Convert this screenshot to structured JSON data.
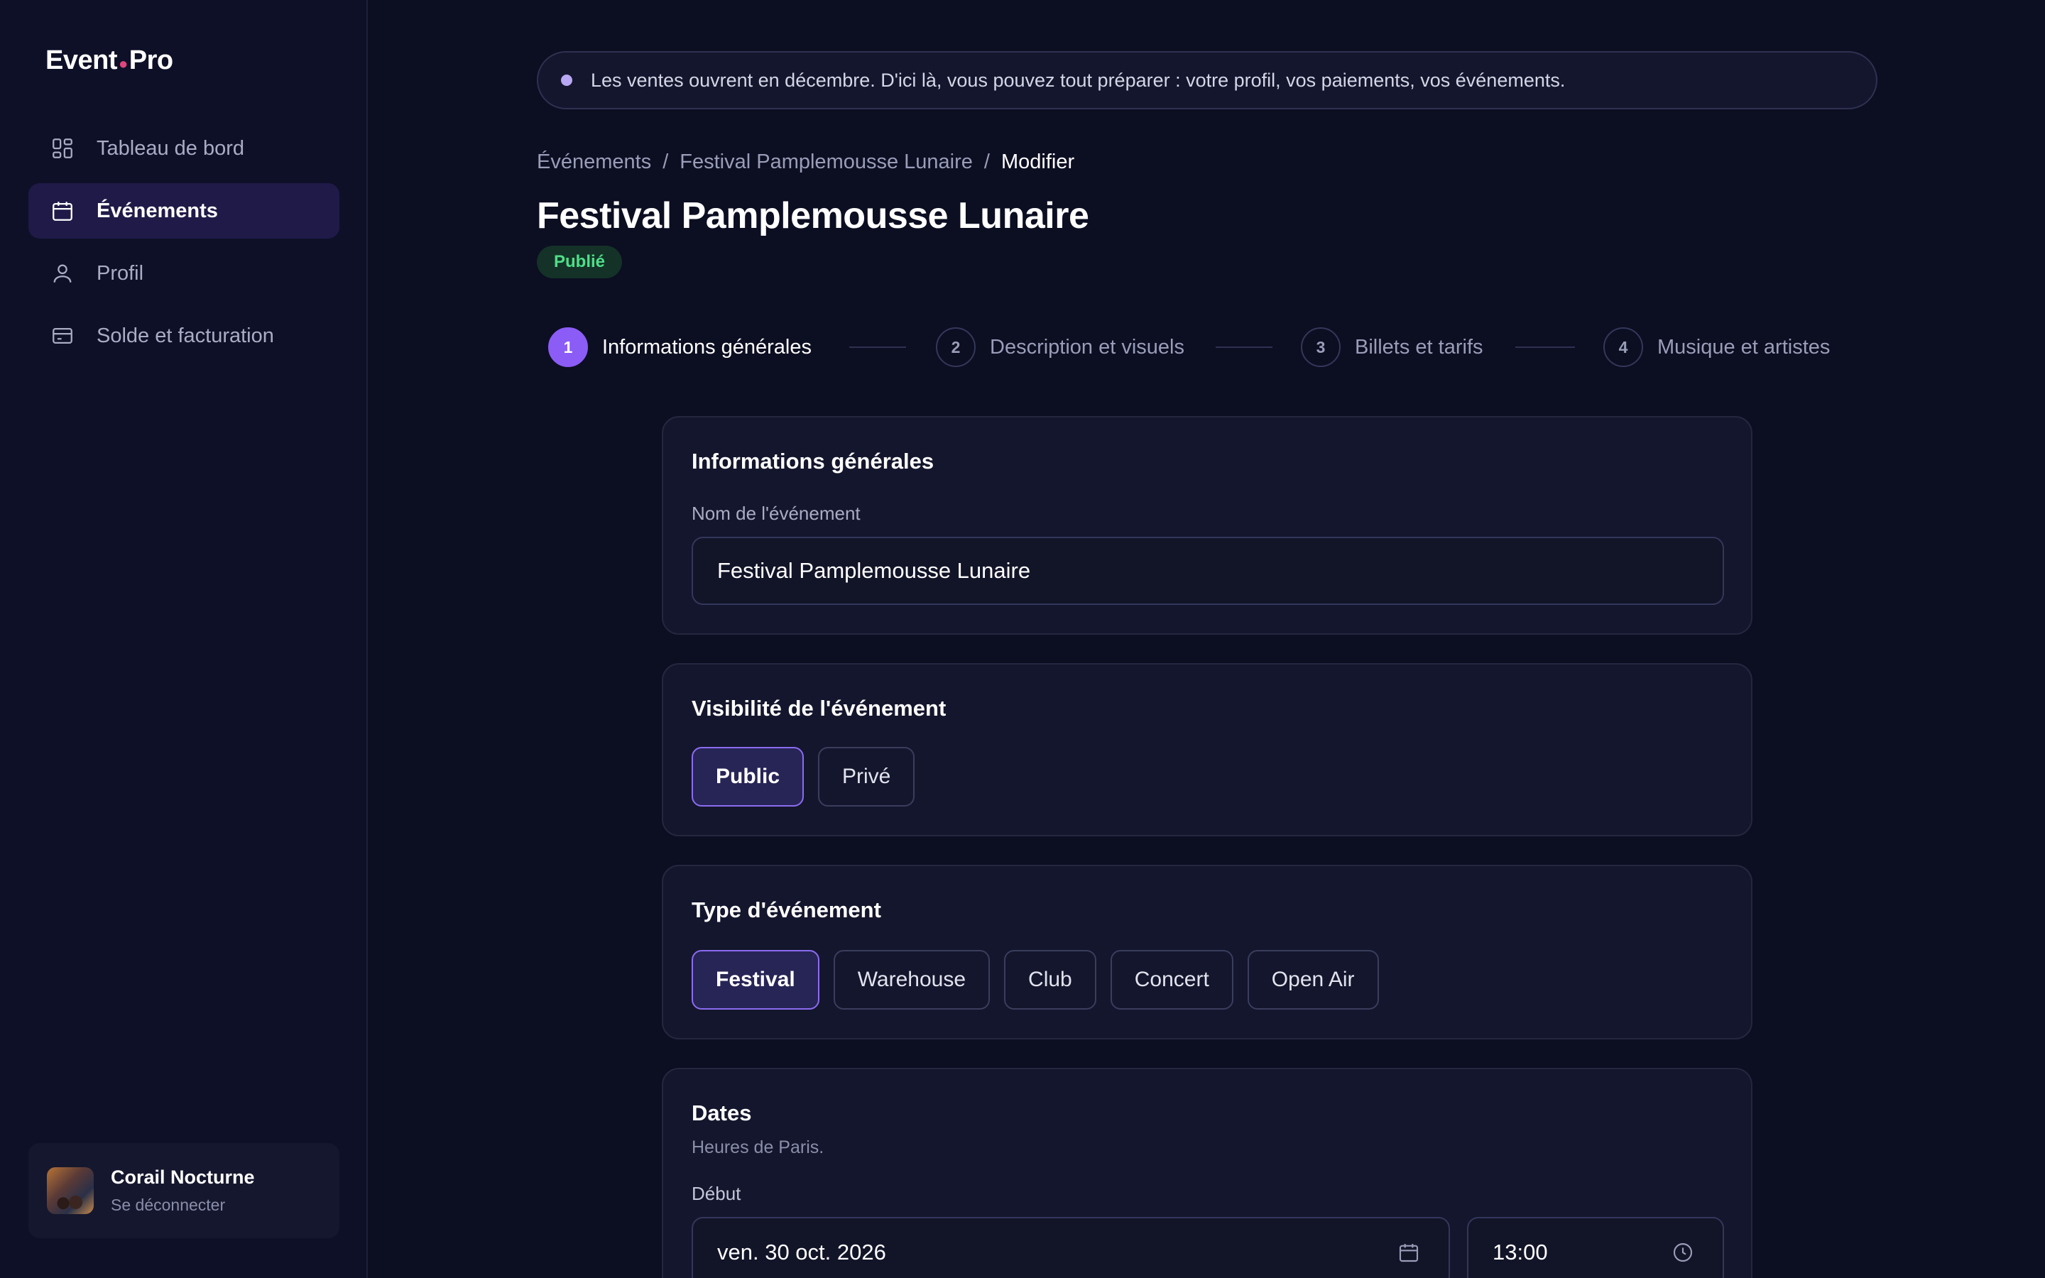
{
  "app": {
    "logo_left": "Event",
    "logo_right": "Pro"
  },
  "sidebar": {
    "items": [
      {
        "label": "Tableau de bord",
        "icon": "dashboard-icon"
      },
      {
        "label": "Événements",
        "icon": "calendar-icon",
        "active": true
      },
      {
        "label": "Profil",
        "icon": "user-icon"
      },
      {
        "label": "Solde et facturation",
        "icon": "credit-card-icon"
      }
    ],
    "user": {
      "name": "Corail Nocturne",
      "logout": "Se déconnecter"
    }
  },
  "banner": {
    "text": "Les ventes ouvrent en décembre. D'ici là, vous pouvez tout préparer : votre profil, vos paiements, vos événements."
  },
  "breadcrumb": {
    "item1": "Événements",
    "item2": "Festival Pamplemousse Lunaire",
    "item3": "Modifier",
    "sep": "/"
  },
  "page": {
    "title": "Festival Pamplemousse Lunaire",
    "status": "Publié"
  },
  "stepper": {
    "steps": [
      {
        "num": "1",
        "label": "Informations générales",
        "active": true
      },
      {
        "num": "2",
        "label": "Description et visuels"
      },
      {
        "num": "3",
        "label": "Billets et tarifs"
      },
      {
        "num": "4",
        "label": "Musique et artistes"
      }
    ]
  },
  "general": {
    "title": "Informations générales",
    "name_label": "Nom de l'événement",
    "name_value": "Festival Pamplemousse Lunaire"
  },
  "visibility": {
    "title": "Visibilité de l'événement",
    "options": [
      "Public",
      "Privé"
    ],
    "selected": "Public"
  },
  "event_type": {
    "title": "Type d'événement",
    "options": [
      "Festival",
      "Warehouse",
      "Club",
      "Concert",
      "Open Air"
    ],
    "selected": "Festival"
  },
  "dates": {
    "title": "Dates",
    "subtitle": "Heures de Paris.",
    "start_label": "Début",
    "start_date": "ven. 30 oct. 2026",
    "start_time": "13:00"
  },
  "colors": {
    "accent": "#8b5cf6",
    "published": "#4ede88",
    "bg": "#0c0e22",
    "sidebar": "#0e1028"
  }
}
